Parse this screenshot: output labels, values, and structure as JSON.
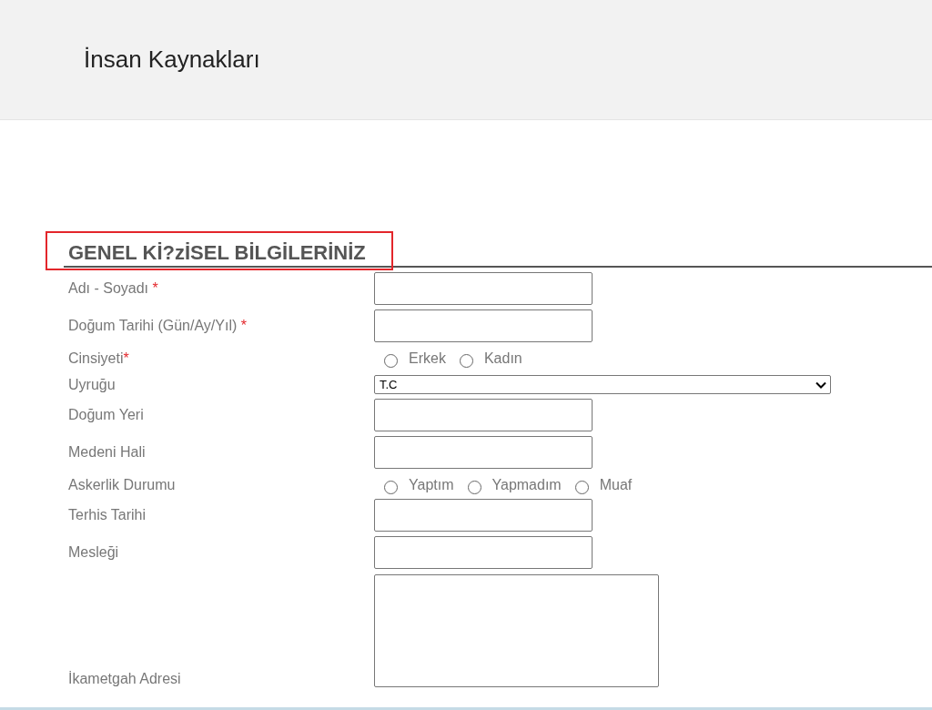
{
  "header": {
    "title": "İnsan Kaynakları"
  },
  "section": {
    "title": "GENEL Kİ?zİSEL BİLGİLERİNİZ",
    "highlighted": true
  },
  "fields": [
    {
      "kind": "text",
      "label": "Adı - Soyadı",
      "required_mark": " *"
    },
    {
      "kind": "text",
      "label": "Doğum Tarihi (Gün/Ay/Yıl)",
      "required_mark": " *"
    },
    {
      "kind": "radio",
      "label": "Cinsiyeti",
      "required_mark": "*",
      "options": [
        {
          "label": "Erkek",
          "selected": false
        },
        {
          "label": "Kadın",
          "selected": false
        }
      ]
    },
    {
      "kind": "select",
      "label": "Uyruğu",
      "value": "T.C"
    },
    {
      "kind": "text",
      "label": "Doğum Yeri"
    },
    {
      "kind": "text",
      "label": "Medeni Hali"
    },
    {
      "kind": "radio",
      "label": "Askerlik Durumu",
      "options": [
        {
          "label": "Yaptım",
          "selected": false
        },
        {
          "label": "Yapmadım",
          "selected": false
        },
        {
          "label": "Muaf",
          "selected": false
        }
      ]
    },
    {
      "kind": "text",
      "label": "Terhis Tarihi"
    },
    {
      "kind": "text",
      "label": "Mesleği"
    },
    {
      "kind": "textarea",
      "label": "İkametgah Adresi"
    }
  ]
}
